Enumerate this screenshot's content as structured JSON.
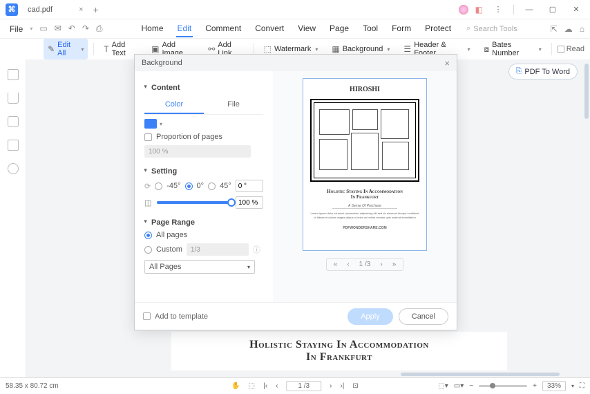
{
  "window": {
    "title": "cad.pdf"
  },
  "menubar": {
    "file": "File",
    "tabs": [
      "Home",
      "Edit",
      "Comment",
      "Convert",
      "View",
      "Page",
      "Tool",
      "Form",
      "Protect"
    ],
    "active_tab": "Edit",
    "search_placeholder": "Search Tools"
  },
  "toolbar": {
    "edit_all": "Edit All",
    "add_text": "Add Text",
    "add_image": "Add Image",
    "add_link": "Add Link",
    "watermark": "Watermark",
    "background": "Background",
    "header_footer": "Header & Footer",
    "bates_number": "Bates Number",
    "read": "Read"
  },
  "pdf_to_word": "PDF To Word",
  "dialog": {
    "title": "Background",
    "content_label": "Content",
    "sub_tabs": {
      "color": "Color",
      "file": "File"
    },
    "proportion": "Proportion of pages",
    "proportion_value": "100  %",
    "setting_label": "Setting",
    "rotation": {
      "neg45": "-45°",
      "zero": "0°",
      "pos45": "45°"
    },
    "rotation_input": "0 °",
    "opacity_input": "100 %",
    "page_range_label": "Page Range",
    "all_pages": "All pages",
    "custom": "Custom",
    "custom_hint": "1/3",
    "range_select": "All Pages",
    "add_template": "Add to template",
    "apply": "Apply",
    "cancel": "Cancel",
    "preview": {
      "title": "HIROSHI",
      "caption_1": "Holistic Staying In Accommodation",
      "caption_2": "In Frankfurt",
      "sub": "A Sense Of Purchase",
      "footer": "PDFWONDERSHARE.COM",
      "pager": "1 /3"
    }
  },
  "page_behind": {
    "line1": "Holistic Staying In Accommodation",
    "line2": "In Frankfurt"
  },
  "statusbar": {
    "dims": "58.35 x 80.72 cm",
    "page": "1 /3",
    "zoom": "33%"
  }
}
